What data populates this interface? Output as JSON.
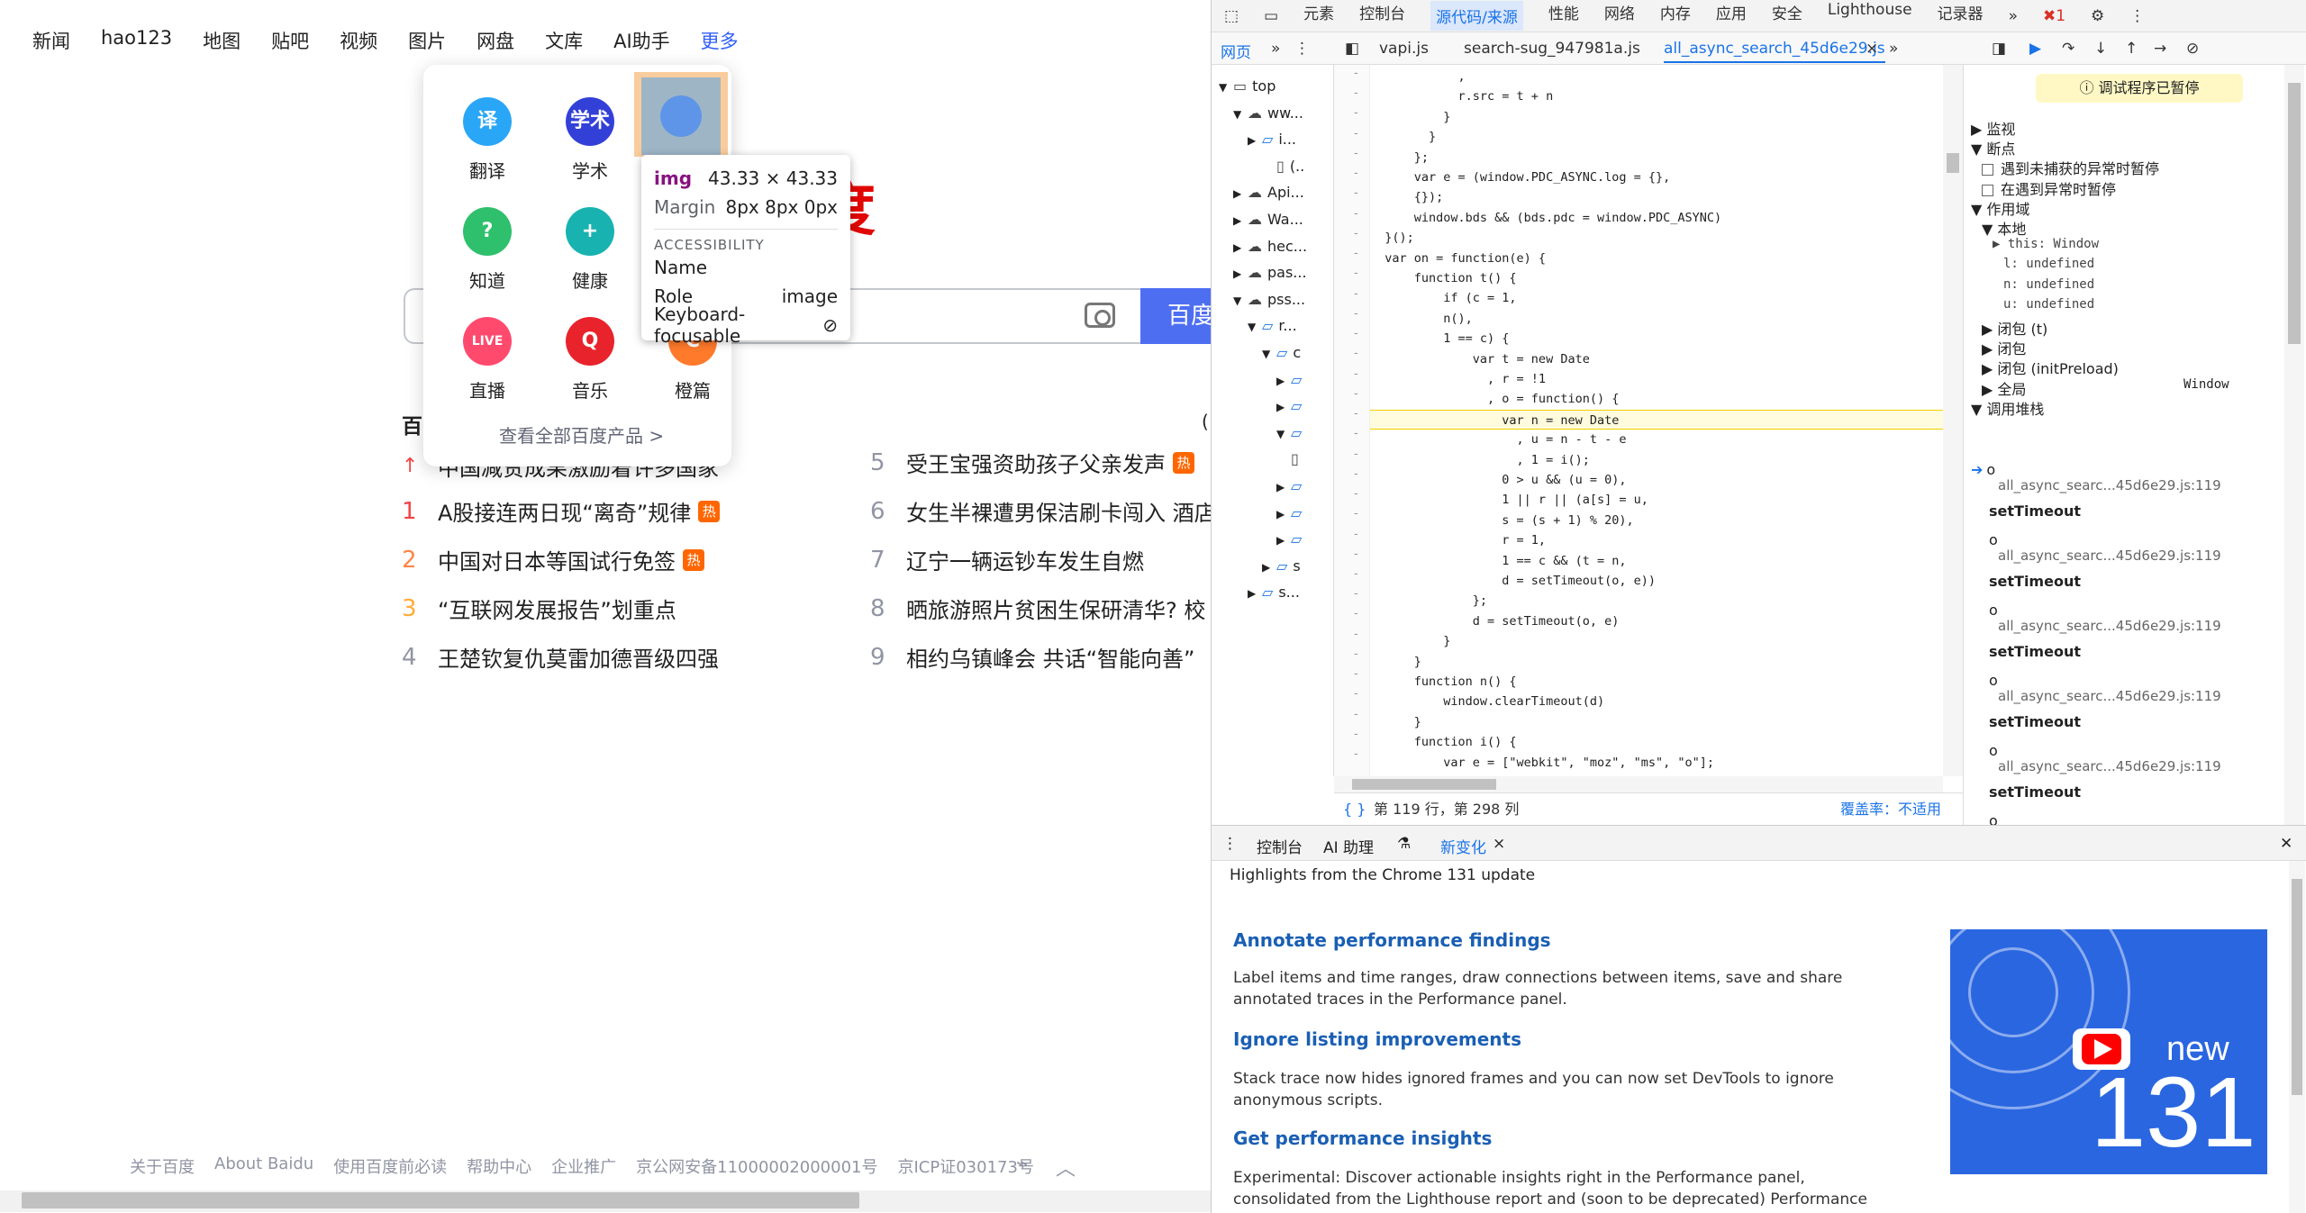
{
  "page": {
    "nav": [
      "新闻",
      "hao123",
      "地图",
      "贴吧",
      "视频",
      "图片",
      "网盘",
      "文库",
      "AI助手"
    ],
    "nav_more": "更多",
    "logo_text": "百度",
    "search_button": "百度",
    "hot_title": "百",
    "hot_right_fragment": "(",
    "hot_left": [
      {
        "n": "1",
        "text": "A股接连两日现“离奇”规律",
        "badge": "热"
      },
      {
        "n": "2",
        "text": "中国对日本等国试行免签",
        "badge": "热"
      },
      {
        "n": "3",
        "text": "“互联网发展报告”划重点",
        "badge": ""
      },
      {
        "n": "4",
        "text": "王楚钦复仇莫雷加德晋级四强",
        "badge": ""
      }
    ],
    "hot_right": [
      {
        "n": "5",
        "text": "受王宝强资助孩子父亲发声",
        "badge": "热"
      },
      {
        "n": "6",
        "text": "女生半裸遭男保洁刷卡闯入 酒店",
        "badge": ""
      },
      {
        "n": "7",
        "text": "辽宁一辆运钞车发生自燃",
        "badge": ""
      },
      {
        "n": "8",
        "text": "晒旅游照片贫困生保研清华? 校",
        "badge": ""
      },
      {
        "n": "9",
        "text": "相约乌镇峰会 共话“智能向善”",
        "badge": ""
      }
    ],
    "hot_top_partial": "中国减贫成果激励着许多国家",
    "popup": {
      "apps": [
        {
          "label": "翻译",
          "icon": "translate-icon",
          "icon_text": "译",
          "color": "#2aa6f6"
        },
        {
          "label": "学术",
          "icon": "scholar-icon",
          "icon_text": "学术",
          "color": "#3340d8"
        },
        {
          "label": "",
          "icon": "image-icon",
          "icon_text": "",
          "color": "#4e8df0"
        },
        {
          "label": "知道",
          "icon": "zhidao-icon",
          "icon_text": "?",
          "color": "#2fc06d"
        },
        {
          "label": "健康",
          "icon": "health-icon",
          "icon_text": "+",
          "color": "#18b3b1"
        },
        {
          "label": "直播",
          "icon": "live-icon",
          "icon_text": "LIVE",
          "color": "#ff4a6e"
        },
        {
          "label": "音乐",
          "icon": "music-icon",
          "icon_text": "Q",
          "color": "#e8232c"
        },
        {
          "label": "橙篇",
          "icon": "chengpian-icon",
          "icon_text": "C",
          "color": "#ff7a2b"
        }
      ],
      "all_products": "查看全部百度产品 >"
    },
    "tooltip": {
      "tag": "img",
      "size": "43.33 × 43.33",
      "margin_label": "Margin",
      "margin_value": "8px 8px 0px",
      "section": "ACCESSIBILITY",
      "name_label": "Name",
      "role_label": "Role",
      "role_value": "image",
      "focus_label": "Keyboard-focusable"
    },
    "footer": [
      "关于百度",
      "About Baidu",
      "使用百度前必读",
      "帮助中心",
      "企业推广",
      "京公网安备11000002000001号",
      "京ICP证030173号"
    ]
  },
  "devtools": {
    "tabs": [
      "元素",
      "控制台",
      "源代码/来源",
      "性能",
      "网络",
      "内存",
      "应用",
      "安全",
      "Lighthouse",
      "记录器"
    ],
    "active_tab": "源代码/来源",
    "error_count": "1",
    "sub_left": [
      "网页"
    ],
    "files": [
      "vapi.js",
      "search-sug_947981a.js",
      "all_async_search_45d6e29.js"
    ],
    "tree": [
      {
        "indent": 0,
        "text": "top",
        "arrow": "▼",
        "icon": "frame"
      },
      {
        "indent": 1,
        "text": "ww...",
        "arrow": "▼",
        "icon": "cloud"
      },
      {
        "indent": 2,
        "text": "i...",
        "arrow": "▶",
        "icon": "folder"
      },
      {
        "indent": 3,
        "text": "(..",
        "arrow": "",
        "icon": "file"
      },
      {
        "indent": 1,
        "text": "Api...",
        "arrow": "▶",
        "icon": "cloud"
      },
      {
        "indent": 1,
        "text": "Wa...",
        "arrow": "▶",
        "icon": "cloud"
      },
      {
        "indent": 1,
        "text": "hec...",
        "arrow": "▶",
        "icon": "cloud"
      },
      {
        "indent": 1,
        "text": "pas...",
        "arrow": "▶",
        "icon": "cloud"
      },
      {
        "indent": 1,
        "text": "pss...",
        "arrow": "▼",
        "icon": "cloud"
      },
      {
        "indent": 2,
        "text": "r...",
        "arrow": "▼",
        "icon": "folder"
      },
      {
        "indent": 3,
        "text": "c",
        "arrow": "▼",
        "icon": "folder"
      },
      {
        "indent": 4,
        "text": "",
        "arrow": "▶",
        "icon": "folder"
      },
      {
        "indent": 4,
        "text": "",
        "arrow": "▶",
        "icon": "folder"
      },
      {
        "indent": 4,
        "text": "",
        "arrow": "▼",
        "icon": "folder"
      },
      {
        "indent": 4,
        "text": "",
        "arrow": "",
        "icon": "file"
      },
      {
        "indent": 4,
        "text": "",
        "arrow": "▶",
        "icon": "folder"
      },
      {
        "indent": 4,
        "text": "",
        "arrow": "▶",
        "icon": "folder"
      },
      {
        "indent": 4,
        "text": "",
        "arrow": "▶",
        "icon": "folder"
      },
      {
        "indent": 3,
        "text": "s",
        "arrow": "▶",
        "icon": "folder"
      },
      {
        "indent": 2,
        "text": "s...",
        "arrow": "▶",
        "icon": "folder"
      }
    ],
    "code": [
      "            ,",
      "            r.src = t + n",
      "          }",
      "        }",
      "      };",
      "      var e = (window.PDC_ASYNC.log = {},",
      "      {});",
      "      window.bds && (bds.pdc = window.PDC_ASYNC)",
      "  }();",
      "  var on = function(e) {",
      "      function t() {",
      "          if (c = 1,",
      "          n(),",
      "          1 == c) {",
      "              var t = new Date",
      "                , r = !1",
      "                , o = function() {",
      "                  var n = new Date",
      "                    , u = n - t - e",
      "                    , 1 = i();",
      "                  0 > u && (u = 0),",
      "                  1 || r || (a[s] = u,",
      "                  s = (s + 1) % 20),",
      "                  r = 1,",
      "                  1 == c && (t = n,",
      "                  d = setTimeout(o, e))",
      "              };",
      "              d = setTimeout(o, e)",
      "          }",
      "      }",
      "      function n() {",
      "          window.clearTimeout(d)",
      "      }",
      "      function i() {",
      "          var e = [\"webkit\", \"moz\", \"ms\", \"o\"];"
    ],
    "status": "第 119 行，第 298 列",
    "coverage": "覆盖率：不适用",
    "paused": "调试程序已暂停",
    "right_panel": [
      {
        "t": "▶ 监视",
        "bold": false,
        "indent": 0
      },
      {
        "t": "▼ 断点",
        "bold": false,
        "indent": 0
      },
      {
        "t": "遇到未捕获的异常时暂停",
        "bold": false,
        "indent": 1,
        "check": true
      },
      {
        "t": "在遇到异常时暂停",
        "bold": false,
        "indent": 1,
        "check": true
      },
      {
        "t": "▼ 作用域",
        "bold": false,
        "indent": 0
      },
      {
        "t": "▼ 本地",
        "bold": false,
        "indent": 1
      },
      {
        "t": "▶ this: Window",
        "bold": false,
        "indent": 2
      },
      {
        "t": "l: undefined",
        "bold": false,
        "indent": 3
      },
      {
        "t": "n: undefined",
        "bold": false,
        "indent": 3
      },
      {
        "t": "u: undefined",
        "bold": false,
        "indent": 3
      },
      {
        "t": "▶ 闭包 (t)",
        "bold": false,
        "indent": 1
      },
      {
        "t": "▶ 闭包",
        "bold": false,
        "indent": 1
      },
      {
        "t": "▶ 闭包 (initPreload)",
        "bold": false,
        "indent": 1
      },
      {
        "t": "▶ 全局",
        "bold": false,
        "indent": 1,
        "right": "Window"
      },
      {
        "t": "▼ 调用堆栈",
        "bold": false,
        "indent": 0
      }
    ],
    "callstack": [
      {
        "fn": "o",
        "loc": "all_async_searc...45d6e29.js:119",
        "async": "setTimeout"
      },
      {
        "fn": "o",
        "loc": "all_async_searc...45d6e29.js:119",
        "async": "setTimeout"
      },
      {
        "fn": "o",
        "loc": "all_async_searc...45d6e29.js:119",
        "async": "setTimeout"
      },
      {
        "fn": "o",
        "loc": "all_async_searc...45d6e29.js:119",
        "async": "setTimeout"
      },
      {
        "fn": "o",
        "loc": "all_async_searc...45d6e29.js:119",
        "async": "setTimeout"
      },
      {
        "fn": "o",
        "loc": "",
        "async": ""
      }
    ],
    "drawer_tabs": [
      "控制台",
      "AI 助理",
      "新变化"
    ],
    "whatsnew": {
      "intro": "Highlights from the Chrome 131 update",
      "items": [
        {
          "h": "Annotate performance findings",
          "p": "Label items and time ranges, draw connections between items, save and share annotated traces in the Performance panel."
        },
        {
          "h": "Ignore listing improvements",
          "p": "Stack trace now hides ignored frames and you can now set DevTools to ignore anonymous scripts."
        },
        {
          "h": "Get performance insights",
          "p": "Experimental: Discover actionable insights right in the Performance panel, consolidated from the Lighthouse report and (soon to be deprecated) Performance insights panel."
        }
      ],
      "promo_new": "new",
      "promo_num": "131"
    }
  }
}
